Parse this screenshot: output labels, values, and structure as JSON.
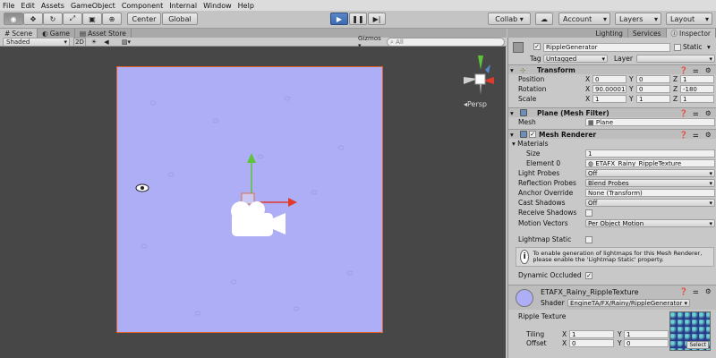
{
  "menu": [
    "File",
    "Edit",
    "Assets",
    "GameObject",
    "Component",
    "Internal",
    "Window",
    "Help"
  ],
  "toolbar": {
    "center": "Center",
    "global": "Global",
    "collab": "Collab ▾",
    "account": "Account",
    "layers": "Layers",
    "layout": "Layout"
  },
  "left_tabs": [
    "Scene",
    "Game",
    "Asset Store"
  ],
  "right_tabs": [
    "Lighting",
    "Services",
    "Inspector"
  ],
  "scene": {
    "shading": "Shaded",
    "mode2d": "2D",
    "gizmos": "Gizmos ▾",
    "search_placeholder": "All",
    "persp": "Persp"
  },
  "inspector": {
    "object_name": "RippleGenerator",
    "static_label": "Static",
    "tag_label": "Tag",
    "tag_value": "Untagged",
    "layer_label": "Layer",
    "layer_value": "",
    "transform": {
      "title": "Transform",
      "position": {
        "label": "Position",
        "x": "0",
        "y": "0",
        "z": "1"
      },
      "rotation": {
        "label": "Rotation",
        "x": "90.00001",
        "y": "0",
        "z": "-180"
      },
      "scale": {
        "label": "Scale",
        "x": "1",
        "y": "1",
        "z": "1"
      }
    },
    "mesh_filter": {
      "title": "Plane (Mesh Filter)",
      "mesh_label": "Mesh",
      "mesh_value": "Plane"
    },
    "mesh_renderer": {
      "title": "Mesh Renderer",
      "materials": "Materials",
      "size_label": "Size",
      "size_value": "1",
      "element0_label": "Element 0",
      "element0_value": "ETAFX_Rainy_RippleTexture",
      "light_probes_label": "Light Probes",
      "light_probes_value": "Off",
      "reflection_label": "Reflection Probes",
      "reflection_value": "Blend Probes",
      "anchor_label": "Anchor Override",
      "anchor_value": "None (Transform)",
      "cast_label": "Cast Shadows",
      "cast_value": "Off",
      "receive_label": "Receive Shadows",
      "motion_label": "Motion Vectors",
      "motion_value": "Per Object Motion",
      "lightmap_label": "Lightmap Static",
      "info": "To enable generation of lightmaps for this Mesh Renderer, please enable the 'Lightmap Static' property.",
      "dynamic_label": "Dynamic Occluded"
    },
    "material": {
      "title": "ETAFX_Rainy_RippleTexture",
      "shader_label": "Shader",
      "shader_value": "EngineTA/FX/Rainy/RippleGenerator",
      "ripple_label": "Ripple Texture",
      "tiling_label": "Tiling",
      "offset_label": "Offset",
      "tiling_x": "1",
      "tiling_y": "1",
      "offset_x": "0",
      "offset_y": "0",
      "select": "Select"
    }
  },
  "axis_labels": {
    "x": "X",
    "y": "Y",
    "z": "Z"
  },
  "colors": {
    "plane": "#aeaef6",
    "play_blue": "#3b6ab2",
    "gizmo_x": "#e03a2a",
    "gizmo_y": "#5ec43a"
  }
}
